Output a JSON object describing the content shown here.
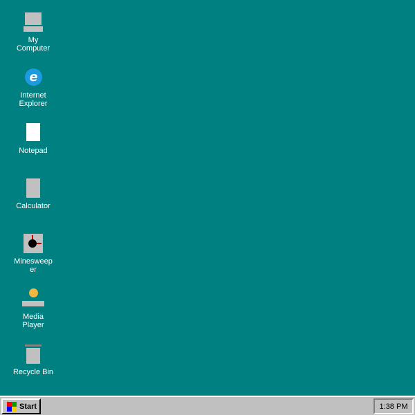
{
  "desktop": {
    "background_color": "#008080",
    "icons": [
      {
        "label": "My Computer",
        "icon": "computer-icon"
      },
      {
        "label": "Internet Explorer",
        "icon": "internet-explorer-icon",
        "glyph": "e"
      },
      {
        "label": "Notepad",
        "icon": "notepad-icon"
      },
      {
        "label": "Calculator",
        "icon": "calculator-icon"
      },
      {
        "label": "Minesweeper",
        "icon": "minesweeper-icon"
      },
      {
        "label": "Media Player",
        "icon": "media-player-icon"
      },
      {
        "label": "Recycle Bin",
        "icon": "recycle-bin-icon"
      }
    ]
  },
  "taskbar": {
    "start_label": "Start",
    "start_logo_colors": [
      "#ff0000",
      "#00a000",
      "#0000ff",
      "#ffd000"
    ],
    "clock": "1:38 PM"
  }
}
